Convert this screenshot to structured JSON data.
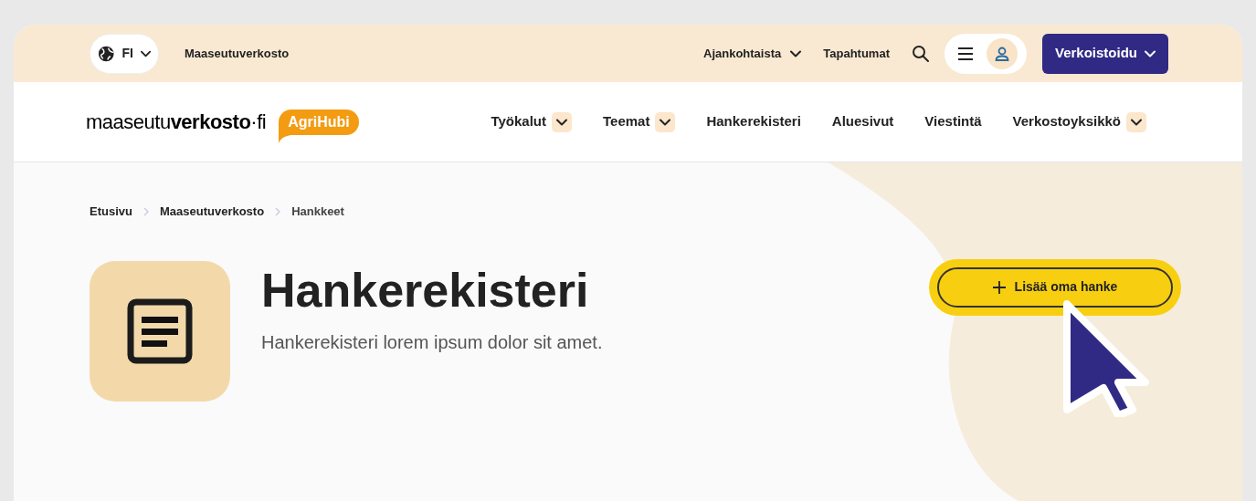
{
  "top_bar": {
    "language": "FI",
    "site_link": "Maaseutuverkosto",
    "links": [
      {
        "label": "Ajankohtaista",
        "has_menu": true
      },
      {
        "label": "Tapahtumat",
        "has_menu": false
      }
    ],
    "cta": "Verkoistoidu"
  },
  "header": {
    "logo": "maaseutu**verkosto**·fi",
    "badge": "AgriHubi",
    "nav": [
      {
        "label": "Työkalut",
        "has_menu": true
      },
      {
        "label": "Teemat",
        "has_menu": true
      },
      {
        "label": "Hankerekisteri",
        "has_menu": false
      },
      {
        "label": "Aluesivut",
        "has_menu": false
      },
      {
        "label": "Viestintä",
        "has_menu": false
      },
      {
        "label": "Verkostoyksikkö",
        "has_menu": true
      }
    ]
  },
  "breadcrumbs": [
    "Etusivu",
    "Maaseutuverkosto",
    "Hankkeet"
  ],
  "hero": {
    "title": "Hankerekisteri",
    "description": "Hankerekisteri lorem ipsum dolor sit amet.",
    "button": "Lisää oma hanke"
  }
}
